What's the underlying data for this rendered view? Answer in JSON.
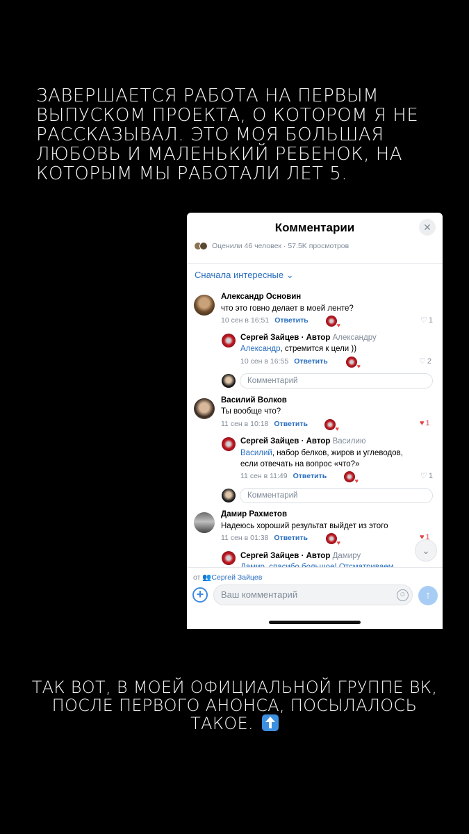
{
  "story": {
    "top_text": "ЗАВЕРШАЕТСЯ РАБОТА НА ПЕРВЫМ\nВЫПУСКОМ ПРОЕКТА, О КОТОРОМ Я НЕ\nРАССКАЗЫВАЛ. ЭТО МОЯ БОЛЬШАЯ\nЛЮБОВЬ И МАЛЕНЬКИЙ РЕБЕНОК, НА\nКОТОРЫМ МЫ РАБОТАЛИ ЛЕТ 5.",
    "bottom_text": "ТАК ВОТ, В МОЕЙ ОФИЦИАЛЬНОЙ ГРУППЕ ВК, ПОСЛЕ ПЕРВОГО АНОНСА, ПОСЫЛАЛОСЬ ТАКОЕ."
  },
  "sheet": {
    "title": "Комментарии",
    "close": "✕",
    "rating": "Оценили 46 человек · 57.5K просмотров",
    "sort_label": "Сначала интересные ⌄"
  },
  "comments": [
    {
      "author": "Александр Основин",
      "text": "что это говно делает в моей ленте?",
      "date": "10 сен в 16:51",
      "reply": "Ответить",
      "like_icon": "♡",
      "likes": "1"
    },
    {
      "author": "Сергей Зайцев · Автор",
      "reply_to": "Александру",
      "mention": "Александр",
      "text": ", стремится к цели ))",
      "date": "10 сен в 16:55",
      "reply": "Ответить",
      "like_icon": "♡",
      "likes": "2"
    },
    {
      "author": "Василий Волков",
      "text": "Ты вообще что?",
      "date": "11 сен в 10:18",
      "reply": "Ответить",
      "like_icon": "♥",
      "likes": "1"
    },
    {
      "author": "Сергей Зайцев · Автор",
      "reply_to": "Василию",
      "mention": "Василий",
      "text": ", набор белков, жиров и углеводов,",
      "text2": "если отвечать на вопрос «что?»",
      "date": "11 сен в 11:49",
      "reply": "Ответить",
      "like_icon": "♡",
      "likes": "1"
    },
    {
      "author": "Дамир Рахметов",
      "text": "Надеюсь хороший результат выйдет из этого",
      "date": "11 сен в 01:38",
      "reply": "Ответить",
      "like_icon": "♥",
      "likes": "1"
    },
    {
      "author": "Сергей Зайцев · Автор",
      "reply_to": "Дамиру",
      "partial_text": "Дамир, спасибо большое! Отсматриваем"
    }
  ],
  "reply_box_placeholder": "Комментарий",
  "composer": {
    "from_label": "от",
    "group_name": "Сергей Зайцев",
    "placeholder": "Ваш комментарий",
    "add": "+",
    "smile": "☺",
    "send": "↑",
    "scroll": "⌄"
  },
  "colors": {
    "link": "#2a6fc0",
    "like_active": "#e64646",
    "secondary": "#818c99"
  }
}
